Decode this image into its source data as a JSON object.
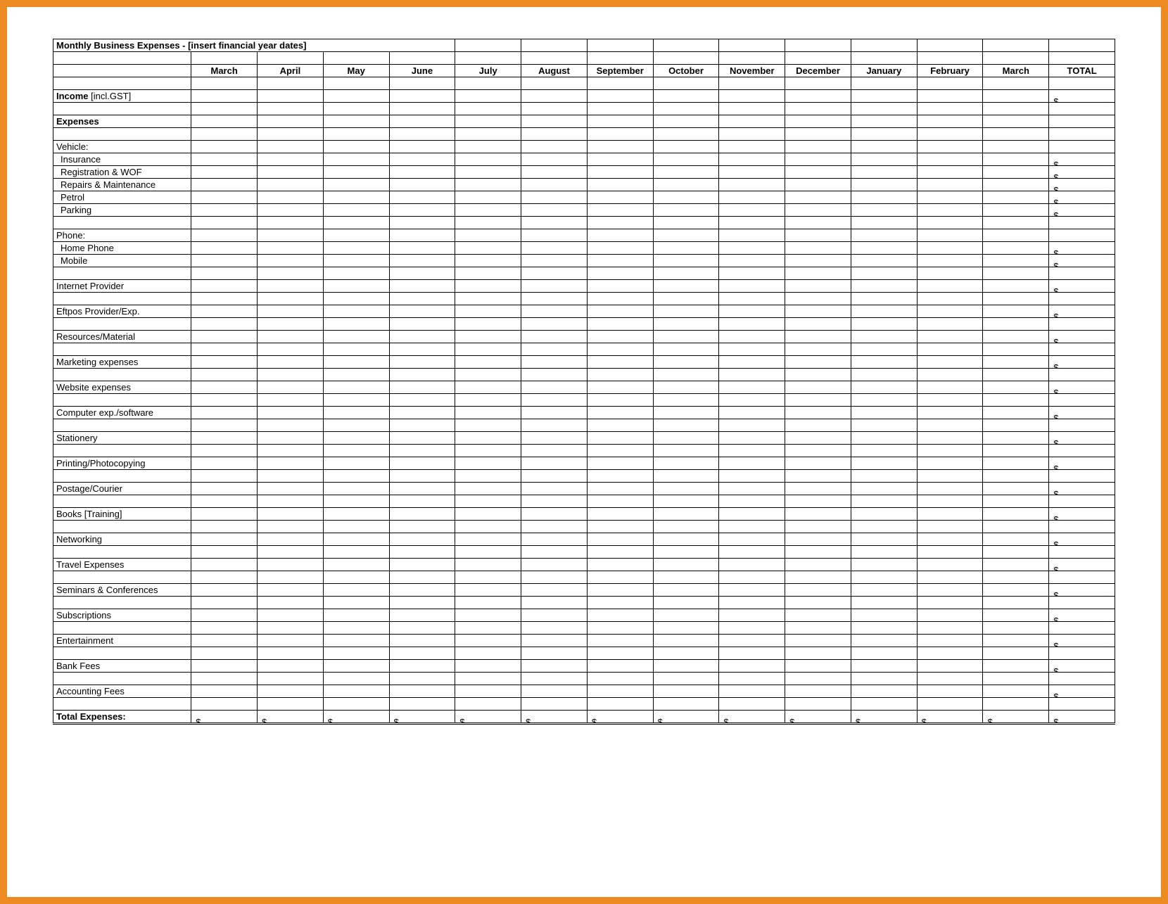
{
  "title": "Monthly Business Expenses - [insert financial year dates]",
  "months": [
    "March",
    "April",
    "May",
    "June",
    "July",
    "August",
    "September",
    "October",
    "November",
    "December",
    "January",
    "February",
    "March"
  ],
  "total_header": "TOTAL",
  "income_label_bold": "Income",
  "income_label_rest": " [incl.GST]",
  "expenses_label": "Expenses",
  "section_vehicle": "Vehicle:",
  "vehicle_items": [
    "Insurance",
    "Registration & WOF",
    "Repairs & Maintenance",
    "Petrol",
    "Parking"
  ],
  "section_phone": "Phone:",
  "phone_items": [
    "Home Phone",
    "Mobile"
  ],
  "single_items": [
    "Internet Provider",
    "Eftpos Provider/Exp.",
    "Resources/Material",
    "Marketing expenses",
    "Website expenses",
    "Computer exp./software",
    "Stationery",
    "Printing/Photocopying",
    "Postage/Courier",
    "Books [Training]",
    "Networking",
    "Travel Expenses",
    "Seminars & Conferences",
    "Subscriptions",
    "Entertainment",
    "Bank Fees",
    "Accounting Fees"
  ],
  "total_expenses_label": "Total Expenses:",
  "currency_symbol": "$",
  "dash": "-"
}
